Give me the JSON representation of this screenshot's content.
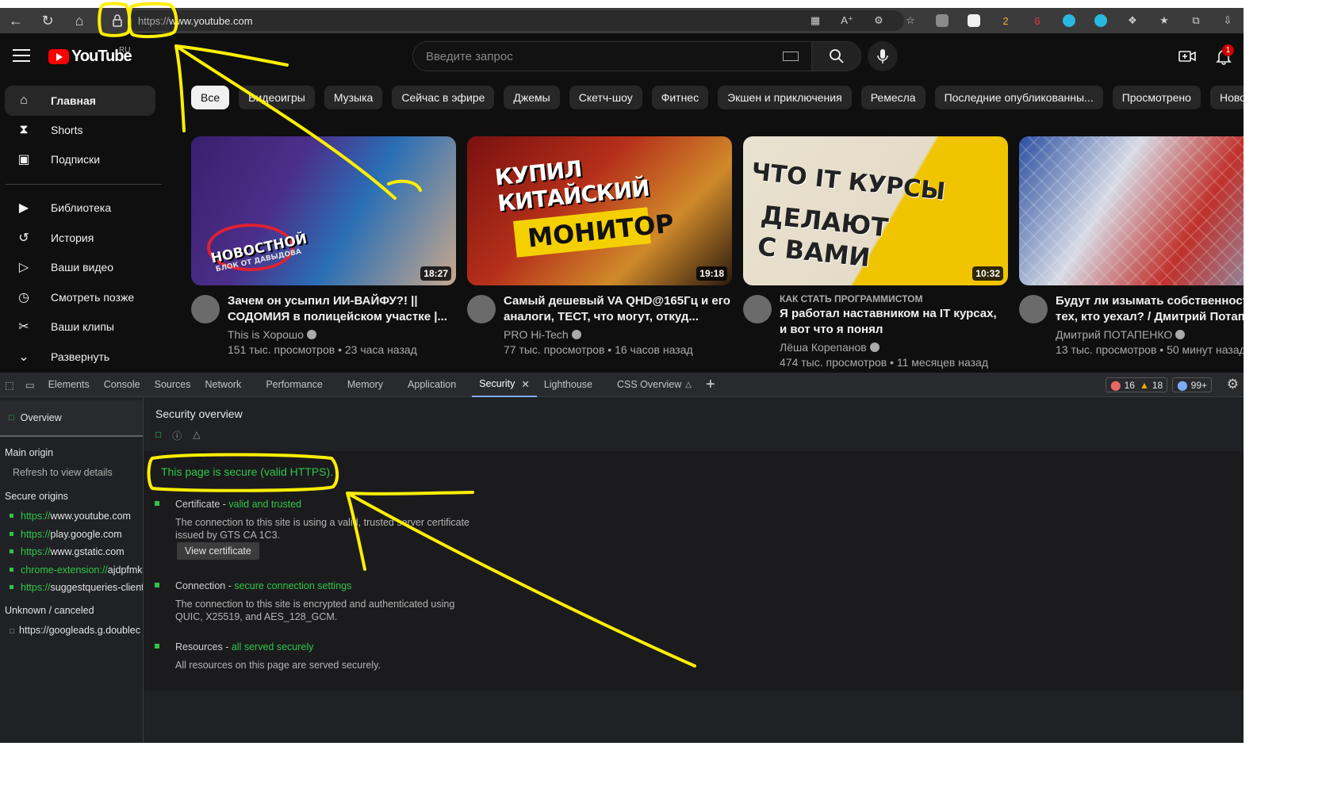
{
  "browser": {
    "url_scheme": "https://",
    "url_host": "www.youtube.com",
    "ext_badges": {
      "badge_a": "2",
      "badge_b": "6"
    }
  },
  "youtube": {
    "logo_text": "YouTube",
    "country": "RU",
    "search_placeholder": "Введите запрос",
    "notification_count": "1",
    "sidebar": [
      {
        "label": "Главная",
        "icon": "home-icon"
      },
      {
        "label": "Shorts",
        "icon": "shorts-icon"
      },
      {
        "label": "Подписки",
        "icon": "subscriptions-icon"
      },
      {
        "label": "Библиотека",
        "icon": "library-icon"
      },
      {
        "label": "История",
        "icon": "history-icon"
      },
      {
        "label": "Ваши видео",
        "icon": "your-videos-icon"
      },
      {
        "label": "Смотреть позже",
        "icon": "watch-later-icon"
      },
      {
        "label": "Ваши клипы",
        "icon": "clips-icon"
      },
      {
        "label": "Развернуть",
        "icon": "chevron-down-icon"
      }
    ],
    "chips": [
      "Все",
      "Видеоигры",
      "Музыка",
      "Сейчас в эфире",
      "Джемы",
      "Скетч-шоу",
      "Фитнес",
      "Экшен и приключения",
      "Ремесла",
      "Последние опубликованны...",
      "Просмотрено",
      "Новое для вас"
    ],
    "videos": [
      {
        "thumb_text": "НОВОСТНОЙ",
        "thumb_sub": "БЛОК ОТ ДАВЫДОВА",
        "duration": "18:27",
        "kicker": "",
        "title": "Зачем он усыпил ИИ-ВАЙФУ?! || СОДОМИЯ в полицейском участке |...",
        "channel": "This is Хорошо",
        "stats": "151 тыс. просмотров • 23 часа назад"
      },
      {
        "thumb_text": "КУПИЛ КИТАЙСКИЙ",
        "thumb_sub": "МОНИТОР",
        "duration": "19:18",
        "kicker": "",
        "title": "Самый дешевый VA QHD@165Гц и его аналоги, ТЕСТ, что могут, откуд...",
        "channel": "PRO Hi-Tech",
        "stats": "77 тыс. просмотров • 16 часов назад"
      },
      {
        "thumb_text": "ЧТО IT КУРСЫ",
        "thumb_sub": "ДЕЛАЮТ С ВАМИ",
        "duration": "10:32",
        "kicker": "КАК СТАТЬ ПРОГРАММИСТОМ",
        "title": "Я работал наставником на IT курсах, и вот что я понял",
        "channel": "Лёша Корепанов",
        "stats": "474 тыс. просмотров • 11 месяцев назад"
      },
      {
        "thumb_text": "",
        "thumb_sub": "",
        "duration": "",
        "kicker": "",
        "title": "Будут ли изымать собственность у тех, кто уехал? / Дмитрий Потапенко",
        "channel": "Дмитрий ПОТАПЕНКО",
        "stats": "13 тыс. просмотров • 50 минут назад"
      }
    ]
  },
  "devtools": {
    "tabs": [
      "Elements",
      "Console",
      "Sources",
      "Network",
      "Performance",
      "Memory",
      "Application",
      "Security",
      "Lighthouse",
      "CSS Overview"
    ],
    "active_tab": "Security",
    "errors": "16",
    "warnings": "18",
    "issues": "99+",
    "sidebar": {
      "overview": "Overview",
      "main_origin": "Main origin",
      "refresh": "Refresh to view details",
      "secure_origins_label": "Secure origins",
      "secure_origins": [
        {
          "scheme": "https://",
          "host": "www.youtube.com"
        },
        {
          "scheme": "https://",
          "host": "play.google.com"
        },
        {
          "scheme": "https://",
          "host": "www.gstatic.com"
        },
        {
          "scheme": "chrome-extension://",
          "host": "ajdpfmk"
        },
        {
          "scheme": "https://",
          "host": "suggestqueries-client"
        }
      ],
      "unknown_label": "Unknown / canceled",
      "unknown_origin": "https://googleads.g.doublec"
    },
    "security": {
      "title": "Security overview",
      "secure_summary": "This page is secure (valid HTTPS).",
      "certificate_head": "Certificate - ",
      "certificate_status": "valid and trusted",
      "certificate_desc": "The connection to this site is using a valid, trusted server certificate issued by GTS CA 1C3.",
      "view_certificate": "View certificate",
      "connection_head": "Connection - ",
      "connection_status": "secure connection settings",
      "connection_desc": "The connection to this site is encrypted and authenticated using QUIC, X25519, and AES_128_GCM.",
      "resources_head": "Resources - ",
      "resources_status": "all served securely",
      "resources_desc": "All resources on this page are served securely."
    }
  },
  "annotation_color": "#ffef00"
}
